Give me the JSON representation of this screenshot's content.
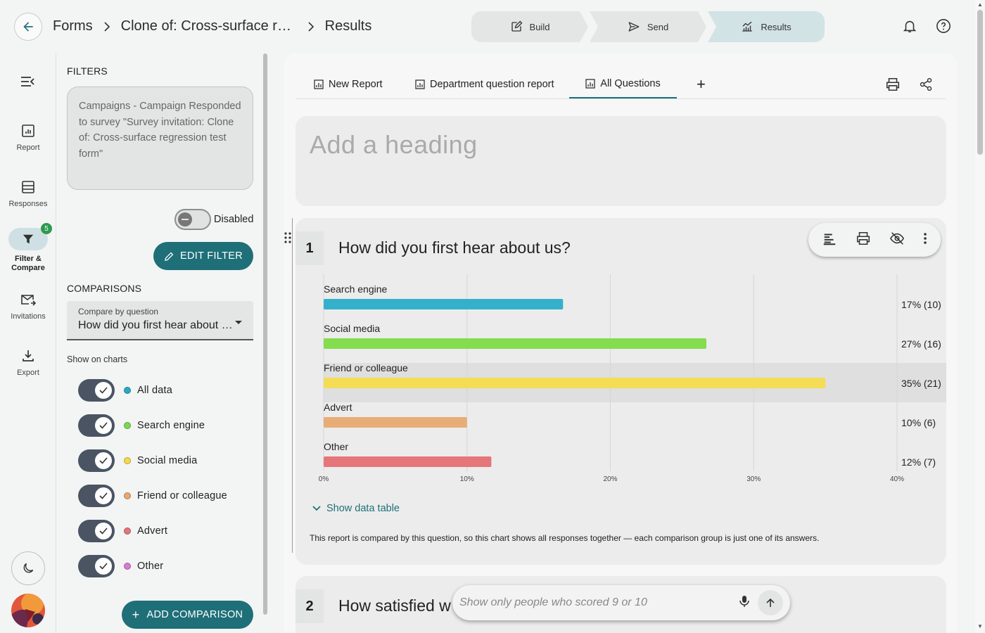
{
  "breadcrumb": {
    "root": "Forms",
    "form": "Clone of: Cross-surface regr...",
    "current": "Results"
  },
  "steps": [
    {
      "label": "Build",
      "icon": "edit-icon"
    },
    {
      "label": "Send",
      "icon": "send-icon"
    },
    {
      "label": "Results",
      "icon": "results-icon",
      "active": true
    }
  ],
  "rail": {
    "items": [
      {
        "label": "Report",
        "icon": "report-icon"
      },
      {
        "label": "Responses",
        "icon": "responses-icon"
      },
      {
        "label": "Filter & Compare",
        "icon": "filter-icon",
        "badge": "5",
        "active": true
      },
      {
        "label": "Invitations",
        "icon": "invitations-icon"
      },
      {
        "label": "Export",
        "icon": "export-icon"
      }
    ]
  },
  "filters": {
    "title": "FILTERS",
    "summary": "Campaigns - Campaign Responded to survey \"Survey invitation: Clone of: Cross-surface regression test form\"",
    "toggle_label": "Disabled",
    "edit_label": "EDIT FILTER"
  },
  "comparisons": {
    "title": "COMPARISONS",
    "select_caption": "Compare by question",
    "select_value": "How did you first hear about us?",
    "show_label": "Show on charts",
    "items": [
      {
        "label": "All data",
        "color": "#2aa9c4"
      },
      {
        "label": "Search engine",
        "color": "#7bd74f"
      },
      {
        "label": "Social media",
        "color": "#f4d94a"
      },
      {
        "label": "Friend or colleague",
        "color": "#e9a76e"
      },
      {
        "label": "Advert",
        "color": "#e2767a"
      },
      {
        "label": "Other",
        "color": "#d77bd0"
      }
    ],
    "add_label": "ADD COMPARISON"
  },
  "tabs": [
    {
      "label": "New Report"
    },
    {
      "label": "Department question report"
    },
    {
      "label": "All Questions",
      "active": true
    }
  ],
  "heading_placeholder": "Add a heading",
  "question1": {
    "number": "1",
    "title": "How did you first hear about us?",
    "show_table_label": "Show data table",
    "note": "This report is compared by this question, so this chart shows all responses together — each comparison group is just one of its answers."
  },
  "question2": {
    "number": "2",
    "title": "How satisfied w"
  },
  "ai_input": {
    "placeholder": "Show only people who scored 9 or 10"
  },
  "chart_data": {
    "type": "bar",
    "orientation": "horizontal",
    "categories": [
      "Search engine",
      "Social media",
      "Friend or colleague",
      "Advert",
      "Other"
    ],
    "values": [
      16.7,
      26.7,
      35,
      10,
      11.7
    ],
    "value_labels": [
      "17% (10)",
      "27% (16)",
      "35% (21)",
      "10% (6)",
      "12% (7)"
    ],
    "colors": [
      "#35b0cb",
      "#83dd4f",
      "#f4dc55",
      "#e8ad77",
      "#e57679"
    ],
    "x_ticks": [
      "0%",
      "10%",
      "20%",
      "30%",
      "40%"
    ],
    "xlim": [
      0,
      40
    ],
    "highlighted": "Friend or colleague",
    "grid": true
  }
}
